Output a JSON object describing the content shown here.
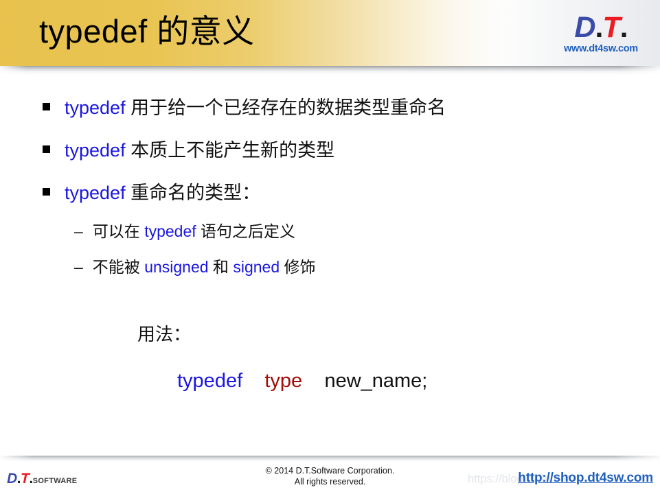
{
  "slide": {
    "title": "typedef 的意义"
  },
  "brand": {
    "logo_d": "D",
    "logo_dot1": ".",
    "logo_t": "T",
    "logo_dot2": ".",
    "url": "www.dt4sw.com",
    "footer_logo_word": "Software"
  },
  "bullets": [
    {
      "keyword": "typedef",
      "rest": " 用于给一个已经存在的数据类型重命名"
    },
    {
      "keyword": "typedef",
      "rest": " 本质上不能产生新的类型"
    },
    {
      "keyword": "typedef",
      "rest": " 重命名的类型："
    }
  ],
  "sub_bullets": [
    {
      "dash": "–",
      "prefix": "可以在 ",
      "keyword": "typedef",
      "suffix": " 语句之后定义"
    },
    {
      "dash": "–",
      "prefix": "不能被 ",
      "keyword": "unsigned",
      "middle": " 和 ",
      "keyword2": "signed",
      "suffix": " 修饰"
    }
  ],
  "usage": {
    "label": "用法：",
    "syntax_typedef": "typedef",
    "syntax_gap1": "    ",
    "syntax_type": "type",
    "syntax_gap2": "    ",
    "syntax_name": "new_name;"
  },
  "footer": {
    "copyright_line1": "© 2014 D.T.Software Corporation.",
    "copyright_line2": "All rights reserved.",
    "link": "http://shop.dt4sw.com",
    "watermark": "https://blog.csdn.net"
  },
  "colors": {
    "header_gold": "#e8c24d",
    "keyword_blue": "#1a16e0",
    "type_red": "#a50b08",
    "logo_blue": "#3b4ba8",
    "logo_red": "#ec1c24",
    "link_blue": "#1f5fbf"
  }
}
